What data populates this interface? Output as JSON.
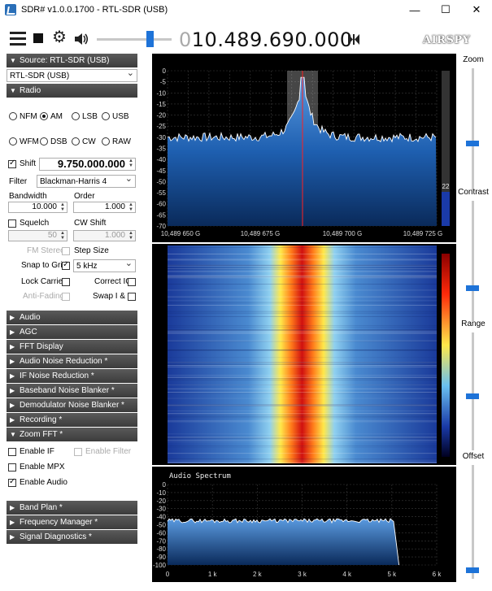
{
  "window": {
    "title": "SDR# v1.0.0.1700 - RTL-SDR (USB)",
    "minimize": "—",
    "maximize": "☐",
    "close": "✕"
  },
  "toolbar": {
    "frequency_prefix": "0",
    "frequency": "10.489.690.000",
    "logo": "AIRSPY",
    "volume_level": 0.72
  },
  "source": {
    "header": "Source: RTL-SDR (USB)",
    "device": "RTL-SDR (USB)"
  },
  "radio": {
    "header": "Radio",
    "modes_row1": [
      "NFM",
      "AM",
      "LSB",
      "USB"
    ],
    "modes_row2": [
      "WFM",
      "DSB",
      "CW",
      "RAW"
    ],
    "selected_mode": "AM",
    "shift_label": "Shift",
    "shift_value": "9.750.000.000",
    "filter_label": "Filter",
    "filter_value": "Blackman-Harris 4",
    "bandwidth_label": "Bandwidth",
    "bandwidth_value": "10.000",
    "order_label": "Order",
    "order_value": "1.000",
    "squelch_label": "Squelch",
    "squelch_value": "50",
    "cw_shift_label": "CW Shift",
    "cw_shift_value": "1.000",
    "fm_stereo_label": "FM Stereo",
    "step_size_label": "Step Size",
    "snap_to_grid_label": "Snap to Grid",
    "step_size_value": "5 kHz",
    "lock_carrier_label": "Lock Carrier",
    "correct_iq_label": "Correct IQ",
    "anti_fading_label": "Anti-Fading",
    "swap_iq_label": "Swap I & Q"
  },
  "sections": [
    "Audio",
    "AGC",
    "FFT Display",
    "Audio Noise Reduction *",
    "IF Noise Reduction *",
    "Baseband Noise Blanker *",
    "Demodulator Noise Blanker *",
    "Recording *",
    "Zoom FFT *"
  ],
  "zoom_fft": {
    "enable_if": "Enable IF",
    "enable_filter": "Enable Filter",
    "enable_mpx": "Enable MPX",
    "enable_audio": "Enable Audio"
  },
  "sections_bottom": [
    "Band Plan *",
    "Frequency Manager *",
    "Signal Diagnostics *"
  ],
  "spectrum": {
    "y_ticks": [
      "0",
      "-5",
      "-10",
      "-15",
      "-20",
      "-25",
      "-30",
      "-35",
      "-40",
      "-45",
      "-50",
      "-55",
      "-60",
      "-65",
      "-70"
    ],
    "x_ticks": [
      "10,489 650 G",
      "10,489 675 G",
      "10,489 700 G",
      "10,489 725 G"
    ],
    "snr_value": "22"
  },
  "audio_spectrum": {
    "title": "Audio Spectrum",
    "y_ticks": [
      "0",
      "-10",
      "-20",
      "-30",
      "-40",
      "-50",
      "-60",
      "-70",
      "-80",
      "-90",
      "-100"
    ],
    "x_ticks": [
      "0",
      "1 k",
      "2 k",
      "3 k",
      "4 k",
      "5 k",
      "6 k"
    ]
  },
  "right_panel": {
    "zoom_label": "Zoom",
    "contrast_label": "Contrast",
    "range_label": "Range",
    "offset_label": "Offset"
  },
  "colors": {
    "accent": "#1e73d8",
    "header_bg": "#4a4a4a",
    "spectrum_fill": "#1e5fb0",
    "marker": "#ff2020"
  }
}
